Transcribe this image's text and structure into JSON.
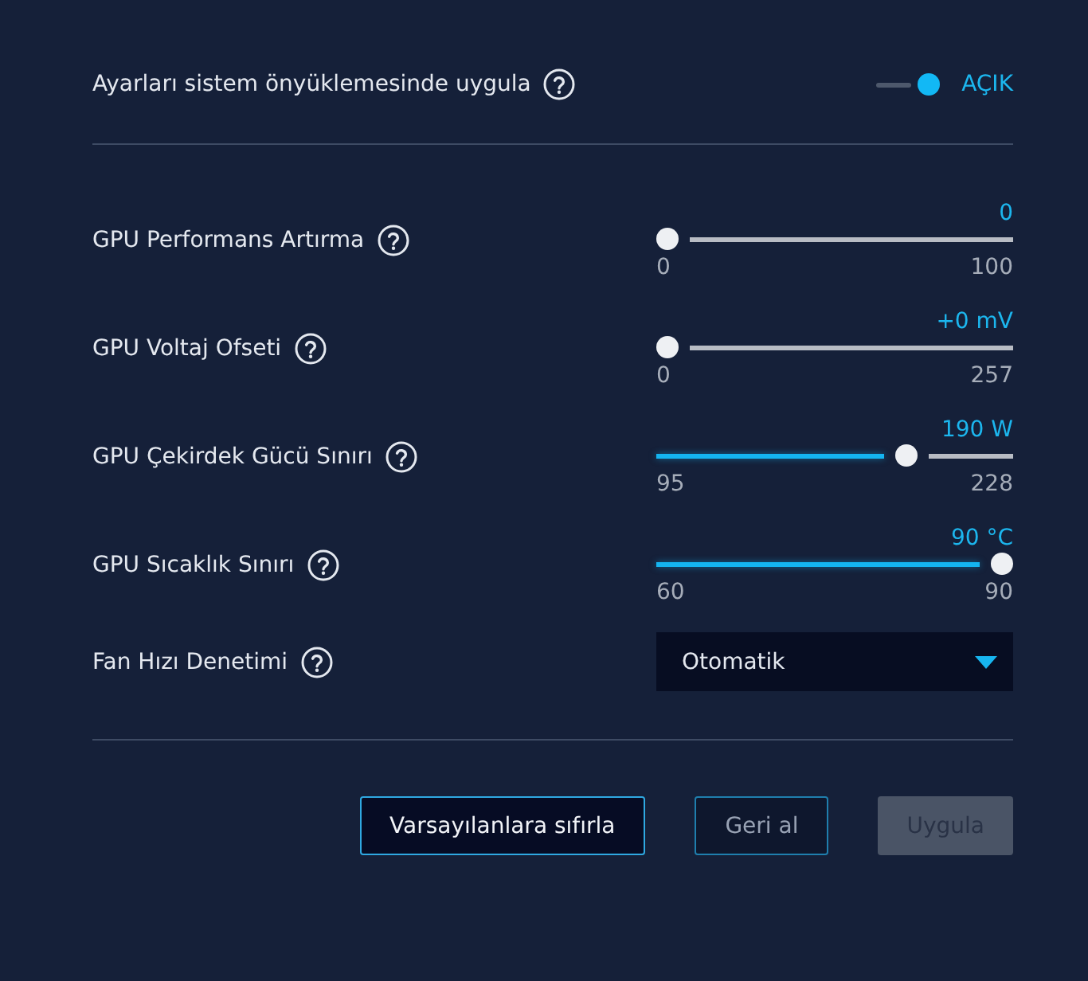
{
  "boot_setting": {
    "label": "Ayarları sistem önyüklemesinde uygula",
    "on": true,
    "state_label": "AÇIK"
  },
  "sliders": [
    {
      "label": "GPU Performans Artırma",
      "value": "0",
      "min": "0",
      "max": "100",
      "level": 0
    },
    {
      "label": "GPU Voltaj Ofseti",
      "value": "+0 mV",
      "min": "0",
      "max": "257",
      "level": 0
    },
    {
      "label": "GPU Çekirdek Gücü Sınırı",
      "value": "190 W",
      "min": "95",
      "max": "228",
      "level": 0.714
    },
    {
      "label": "GPU Sıcaklık Sınırı",
      "value": "90 °C",
      "min": "60",
      "max": "90",
      "level": 1
    }
  ],
  "fan_control": {
    "label": "Fan Hızı Denetimi",
    "value": "Otomatik"
  },
  "buttons": [
    {
      "label": "Varsayılanlara sıfırla",
      "kind": "outline",
      "disabled": false
    },
    {
      "label": "Geri al",
      "kind": "outline",
      "disabled": true
    },
    {
      "label": "Uygula",
      "kind": "filled",
      "disabled": true
    }
  ]
}
